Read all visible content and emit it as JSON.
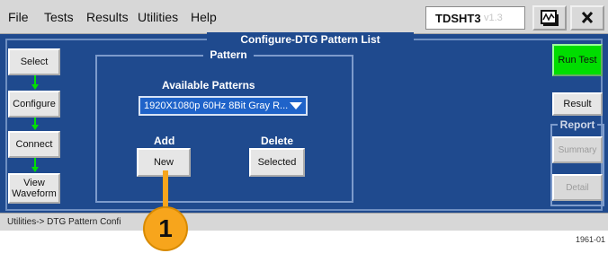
{
  "menu": [
    "File",
    "Tests",
    "Results",
    "Utilities",
    "Help"
  ],
  "app": {
    "name": "TDSHT3",
    "version": "v1.3"
  },
  "window_buttons": [
    "waveform-icon",
    "close-icon"
  ],
  "panel": {
    "title": "Configure-DTG Pattern List",
    "steps": [
      {
        "label": "Select"
      },
      {
        "label": "Configure"
      },
      {
        "label": "Connect"
      },
      {
        "label": "View Waveform"
      }
    ],
    "pattern": {
      "group_label": "Pattern",
      "available_label": "Available Patterns",
      "selected": "1920X1080p 60Hz 8Bit Gray R...",
      "add_label": "Add",
      "new_button": "New",
      "delete_label": "Delete",
      "selected_button": "Selected"
    },
    "right": {
      "run_test": "Run Test",
      "result": "Result",
      "report_label": "Report",
      "summary": "Summary",
      "detail": "Detail"
    }
  },
  "status": "Utilities-> DTG Pattern Confi",
  "callout_number": "1",
  "figure_id": "1961-01",
  "colors": {
    "panel": "#1f4a8e",
    "run": "#00dd00",
    "callout": "#f7a51c",
    "arrow": "#00e000"
  }
}
